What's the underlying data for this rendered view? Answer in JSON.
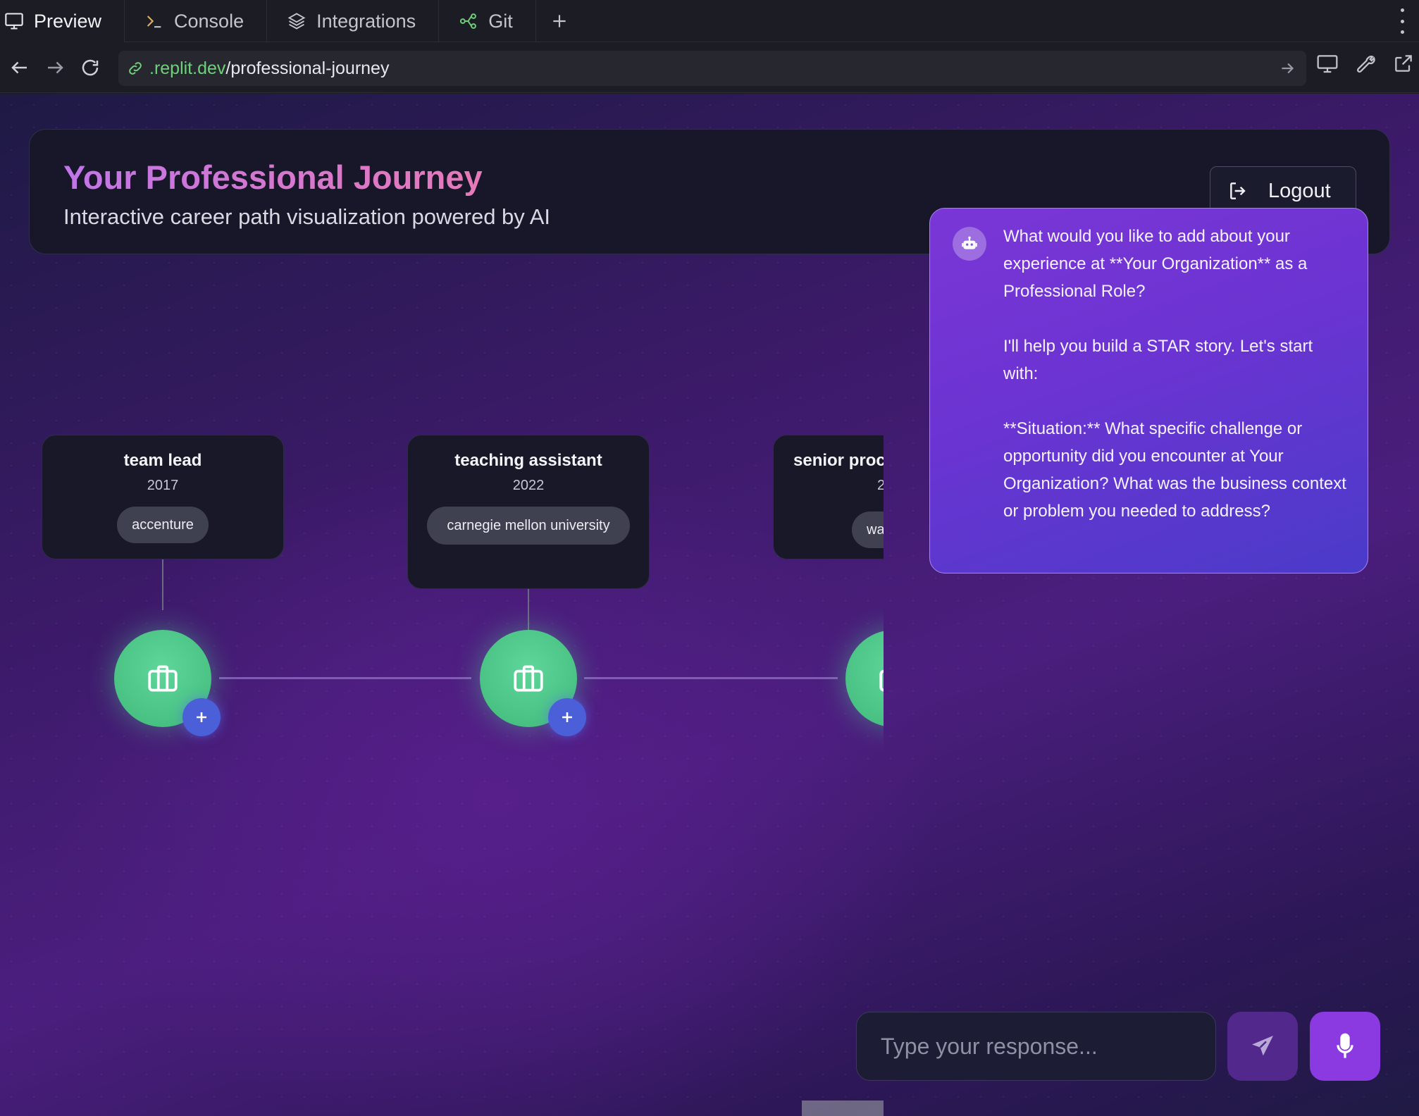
{
  "tabs": [
    {
      "label": "Preview",
      "icon": "monitor-icon",
      "active": true
    },
    {
      "label": "Console",
      "icon": "terminal-icon",
      "active": false
    },
    {
      "label": "Integrations",
      "icon": "layers-icon",
      "active": false
    },
    {
      "label": "Git",
      "icon": "git-branch-icon",
      "active": false
    }
  ],
  "url": {
    "domain": ".replit.dev",
    "path": "/professional-journey"
  },
  "header": {
    "title": "Your Professional Journey",
    "subtitle": "Interactive career path visualization powered by AI",
    "logout_label": "Logout"
  },
  "timeline": [
    {
      "title": "team lead",
      "year": "2017",
      "org": "accenture"
    },
    {
      "title": "teaching assistant",
      "year": "2022",
      "org": "carnegie mellon university"
    },
    {
      "title": "senior proc",
      "year": "2",
      "org": "wa"
    }
  ],
  "chat": {
    "paragraphs": [
      "What would you like to add about your experience at **Your Organization** as a Professional Role?",
      "I'll help you build a STAR story. Let's start with:",
      "**Situation:** What specific challenge or opportunity did you encounter at Your Organization? What was the business context or problem you needed to address?"
    ],
    "input_placeholder": "Type your response..."
  },
  "colors": {
    "accent_green": "#4cc98a",
    "accent_purple": "#8a3ae0",
    "url_green": "#6fd07a"
  }
}
